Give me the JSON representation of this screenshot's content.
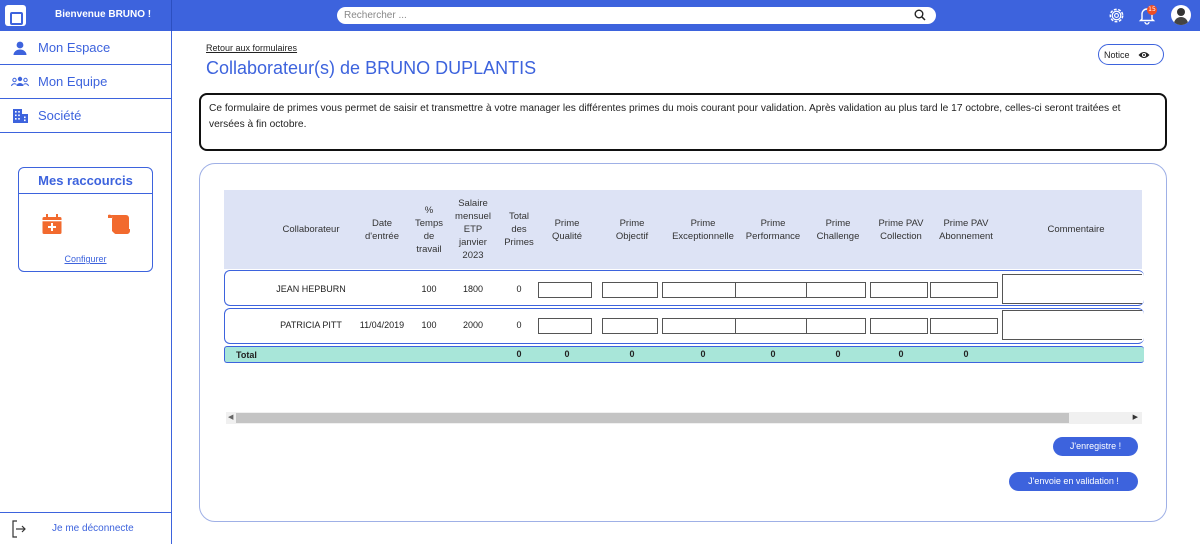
{
  "topbar": {
    "welcome": "Bienvenue BRUNO !",
    "search_placeholder": "Rechercher ...",
    "notification_count": "15"
  },
  "sidebar": {
    "items": [
      {
        "label": "Mon Espace",
        "icon": "user-icon"
      },
      {
        "label": "Mon Equipe",
        "icon": "team-icon"
      },
      {
        "label": "Société",
        "icon": "building-icon"
      }
    ],
    "shortcuts_title": "Mes raccourcis",
    "configure": "Configurer",
    "logout": "Je me déconnecte"
  },
  "main": {
    "back_link": "Retour aux formulaires",
    "title": "Collaborateur(s) de BRUNO DUPLANTIS",
    "notice": "Notice",
    "info": "Ce formulaire de primes vous permet de saisir et transmettre à votre manager les différentes primes du mois courant pour validation. Après validation au plus tard le 17 octobre, celles-ci seront traitées et versées à fin octobre."
  },
  "table": {
    "headers": [
      "Collaborateur",
      "Date d'entrée",
      "% Temps de travail",
      "Salaire mensuel ETP janvier 2023",
      "Total des Primes",
      "Prime Qualité",
      "Prime Objectif",
      "Prime Exceptionnelle",
      "Prime Performance",
      "Prime Challenge",
      "Prime PAV Collection",
      "Prime PAV Abonnement",
      "Commentaire"
    ],
    "rows": [
      {
        "name": "JEAN HEPBURN",
        "date": "",
        "temps": "100",
        "salaire": "1800",
        "total": "0"
      },
      {
        "name": "PATRICIA PITT",
        "date": "11/04/2019",
        "temps": "100",
        "salaire": "2000",
        "total": "0"
      }
    ],
    "total_label": "Total",
    "totals": [
      "0",
      "0",
      "0",
      "0",
      "0",
      "0",
      "0",
      "0"
    ]
  },
  "buttons": {
    "save": "J'enregistre !",
    "submit": "J'envoie en validation !"
  },
  "colors": {
    "primary": "#3d63dd",
    "accent_orange": "#f26a2e",
    "header_bg": "#dde3f5",
    "total_bg": "#a8e6d9"
  }
}
